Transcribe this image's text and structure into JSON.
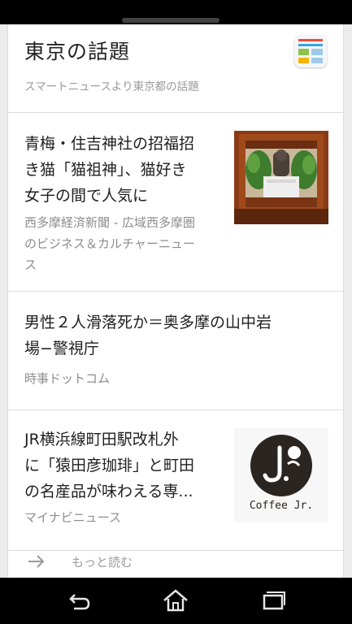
{
  "card": {
    "title": "東京の話題",
    "subtitle": "スマートニュースより東京都の話題"
  },
  "articles": [
    {
      "headline_lines": [
        "青梅・住吉神社の招福招",
        "き猫「猫祖神」、猫好き",
        "女子の間で人気に"
      ],
      "source_lines": [
        "西多摩経済新聞 - 広域西多摩圏",
        "のビジネス＆カルチャーニュー",
        "ス"
      ]
    },
    {
      "headline_lines": [
        "男性２人滑落死か＝奥多摩の山中岩",
        "場−警視庁"
      ],
      "source_lines": [
        "時事ドットコム"
      ]
    },
    {
      "headline_lines": [
        "JR横浜線町田駅改札外",
        "に「猿田彦珈琲」と町田",
        "の名産品が味わえる専..."
      ],
      "source_lines": [
        "マイナビニュース"
      ],
      "thumb_text": "Coffee Jr."
    }
  ],
  "more": {
    "label": "もっと読む"
  },
  "icons": {
    "app": "smartnews-icon",
    "more": "arrow-right-icon",
    "back": "back-icon",
    "home": "home-icon",
    "recents": "recent-apps-icon"
  },
  "colors": {
    "background": "#ececec",
    "card": "#ffffff",
    "text": "#1f1f1f",
    "muted": "#8d8d8d",
    "bars": "#000000"
  }
}
